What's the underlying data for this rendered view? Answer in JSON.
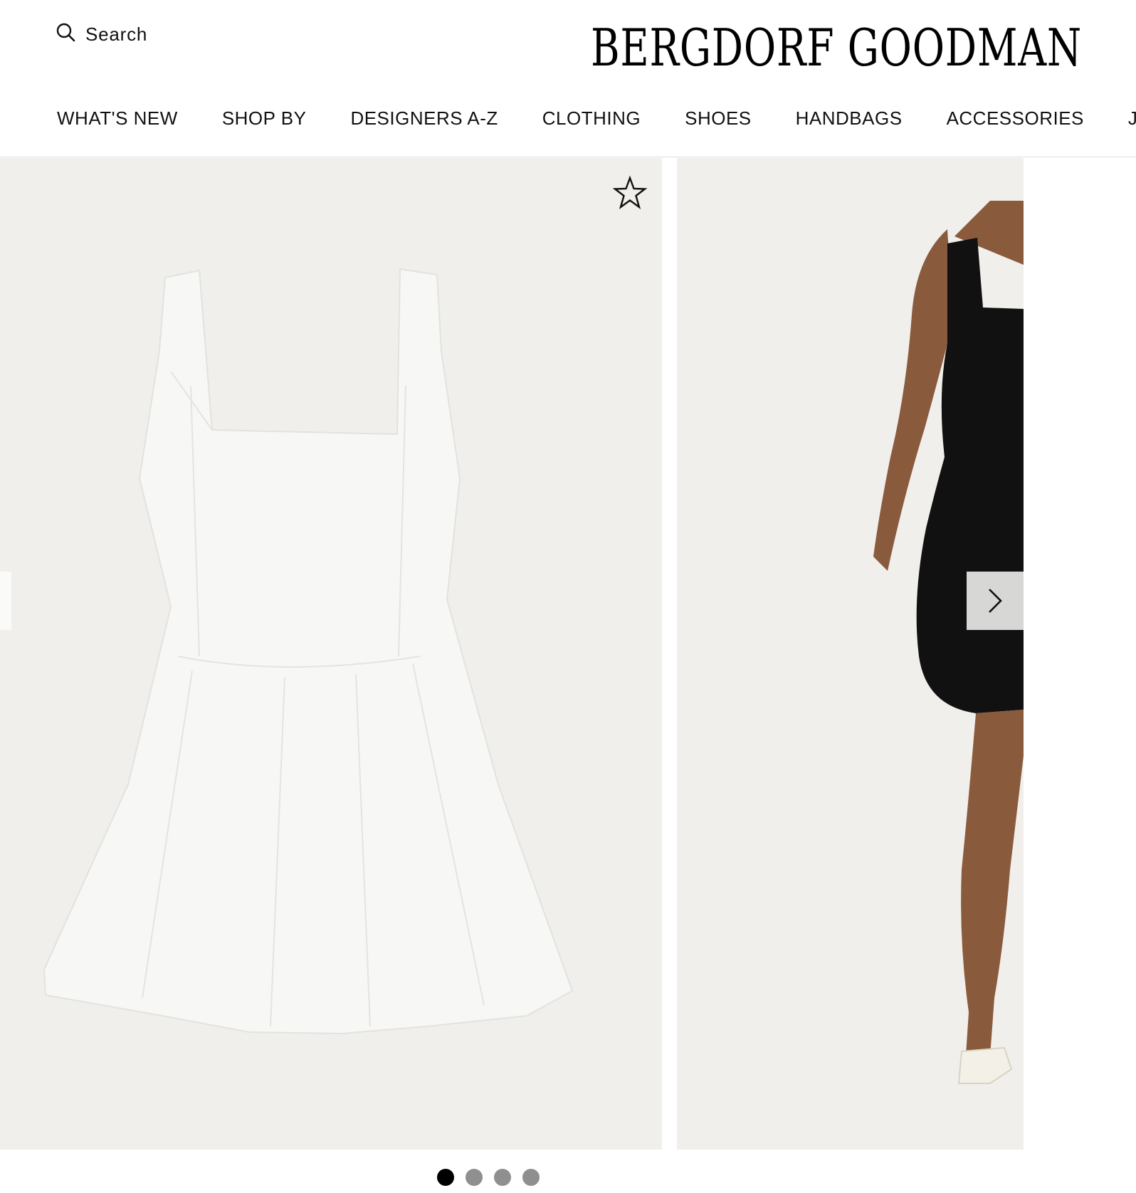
{
  "header": {
    "search_label": "Search",
    "search_icon": "search-icon",
    "brand_logo_text": "BERGDORF GOODMAN"
  },
  "nav": {
    "items": [
      {
        "label": "WHAT'S NEW"
      },
      {
        "label": "SHOP BY"
      },
      {
        "label": "DESIGNERS A-Z"
      },
      {
        "label": "CLOTHING"
      },
      {
        "label": "SHOES"
      },
      {
        "label": "HANDBAGS"
      },
      {
        "label": "ACCESSORIES"
      },
      {
        "label": "JEWEL"
      }
    ]
  },
  "gallery": {
    "favorite_icon": "star-outline-icon",
    "next_icon": "chevron-right-icon",
    "image_count": 4,
    "active_index": 0,
    "colors": {
      "background": "#f0efeb",
      "dress_light": "#f7f7f5",
      "dress_dark": "#111111",
      "skin": "#8a5a3c"
    }
  }
}
